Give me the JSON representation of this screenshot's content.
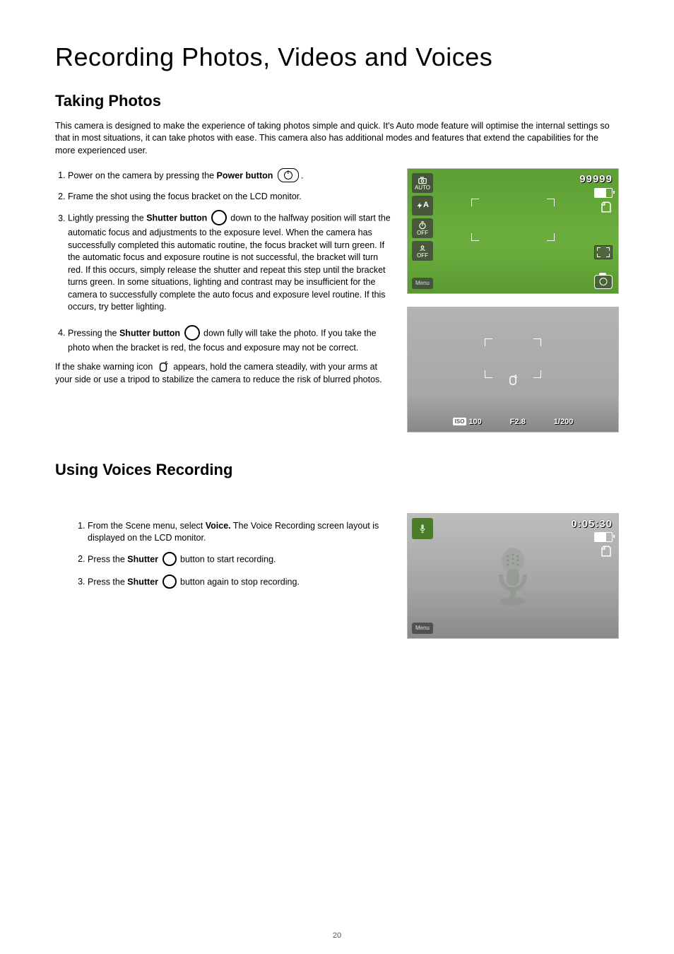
{
  "page_number": "20",
  "h1": "Recording Photos, Videos and Voices",
  "section_photos": {
    "h2": "Taking Photos",
    "intro": "This camera is designed to make the experience of taking photos simple and quick.  It's Auto mode feature will optimise the internal settings so that in most situations, it can take photos with ease.  This camera also has additional modes and features that extend the capabilities for the more experienced user.",
    "step1_a": "Power on the camera by pressing the ",
    "step1_b": "Power button",
    "step1_c": ".",
    "step2": "Frame the shot using the focus bracket on the LCD monitor.",
    "step3_a": "Lightly pressing the ",
    "step3_b": "Shutter button",
    "step3_c": " down to the halfway position will start the automatic focus and adjustments to the exposure level.  When the camera has successfully completed this automatic routine, the focus bracket will turn green.  If the automatic focus and exposure routine is not successful, the bracket will turn red.  If this occurs, simply release the shutter and repeat this step until the bracket turns green.  In some situations, lighting and contrast may be insufficient for the camera to successfully complete the auto focus and exposure level routine.  If this occurs, try better lighting.",
    "step4_a": "Pressing the ",
    "step4_b": "Shutter button",
    "step4_c": " down fully will take the photo.  If you take the photo when the bracket is red, the focus and exposure may not be correct.",
    "shake_a": "If the shake warning icon ",
    "shake_b": " appears, hold the camera steadily, with your arms at your side or use a tripod to stabilize the camera to reduce the risk of blurred photos."
  },
  "lcd1": {
    "box_auto": "AUTO",
    "box_flash": "A",
    "box_timer": "OFF",
    "box_face": "OFF",
    "menu": "Menu",
    "num": "99999"
  },
  "lcd2": {
    "iso_label": "ISO",
    "iso": "100",
    "fstop": "F2.8",
    "shutter": "1/200"
  },
  "section_voice": {
    "h2": "Using Voices Recording",
    "step1_a": "From the Scene menu, select ",
    "step1_b": "Voice.",
    "step1_c": " The Voice Recording screen layout is displayed on the LCD monitor.",
    "step2_a": "Press the ",
    "step2_b": "Shutter",
    "step2_c": " button to start recording.",
    "step3_a": "Press the ",
    "step3_b": "Shutter",
    "step3_c": " button again to stop recording."
  },
  "lcd3": {
    "menu": "Menu",
    "timer": "0:05:30"
  },
  "icons": {
    "power": "power-icon",
    "shutter": "shutter-icon",
    "shake": "shake-warning-icon",
    "camera_auto": "camera-auto-icon",
    "flash_auto": "flash-auto-icon",
    "timer_off": "self-timer-off-icon",
    "face_detect_off": "face-detect-off-icon",
    "menu": "menu-label",
    "battery": "battery-icon",
    "sd": "sd-card-icon",
    "af_frame": "af-frame-icon",
    "camera": "camera-icon",
    "mic": "microphone-icon"
  }
}
